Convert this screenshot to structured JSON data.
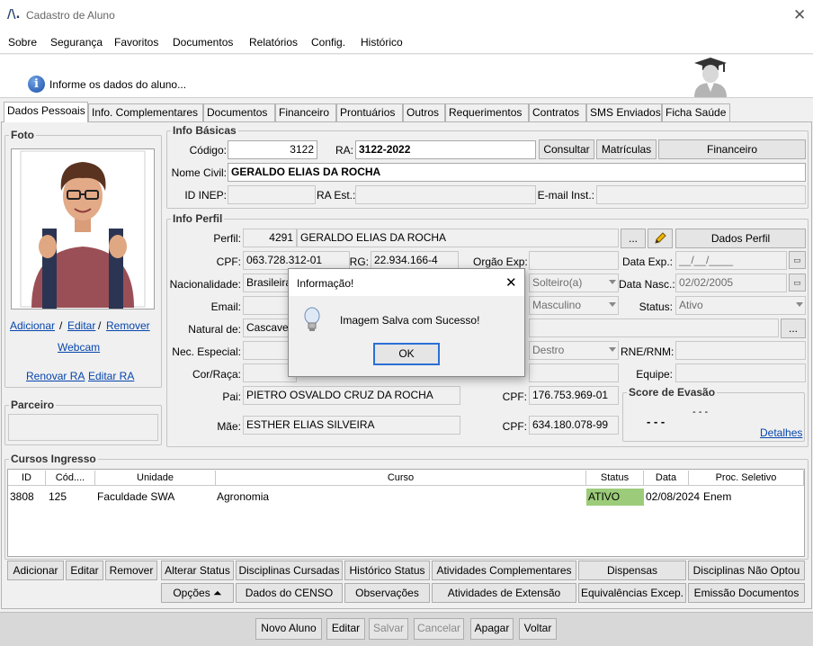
{
  "window": {
    "title": "Cadastro de Aluno",
    "close_glyph": "✕",
    "logo_text": "/\\."
  },
  "menu": [
    "Sobre",
    "Segurança",
    "Favoritos",
    "Documentos",
    "Relatórios",
    "Config.",
    "Histórico"
  ],
  "info": {
    "message": "Informe os dados do aluno...",
    "icon": "info-icon"
  },
  "tabs": [
    "Dados Pessoais",
    "Info. Complementares",
    "Documentos",
    "Financeiro",
    "Prontuários",
    "Outros",
    "Requerimentos",
    "Contratos",
    "SMS Enviados",
    "Ficha Saúde"
  ],
  "foto": {
    "legend": "Foto",
    "adicionar": "Adicionar",
    "editar": "Editar",
    "remover": "Remover",
    "sep": "/",
    "webcam": "Webcam",
    "renovar_ra": "Renovar RA",
    "editar_ra": "Editar RA"
  },
  "parceiro": {
    "legend": "Parceiro",
    "value": ""
  },
  "basicas": {
    "legend": "Info Básicas",
    "codigo_label": "Código:",
    "codigo": "3122",
    "ra_label": "RA:",
    "ra": "3122-2022",
    "consultar": "Consultar",
    "matriculas": "Matrículas",
    "financeiro": "Financeiro",
    "nome_label": "Nome Civil:",
    "nome": "GERALDO ELIAS DA ROCHA",
    "inep_label": "ID INEP:",
    "inep": "",
    "ra_est_label": "RA Est.:",
    "ra_est": "",
    "email_inst_label": "E-mail Inst.:",
    "email_inst": ""
  },
  "perfil": {
    "legend": "Info Perfil",
    "perfil_label": "Perfil:",
    "perfil_id": "4291",
    "perfil_nome": "GERALDO ELIAS DA ROCHA",
    "ellipsis": "...",
    "dados_perfil": "Dados Perfil",
    "cpf_label": "CPF:",
    "cpf": "063.728.312-01",
    "rg_label": "RG:",
    "rg": "22.934.166-4",
    "orgao_label": "Orgão Exp:",
    "orgao": "",
    "data_exp_label": "Data Exp.:",
    "data_exp": "__/__/____",
    "nacionalidade_label": "Nacionalidade:",
    "nacionalidade": "Brasileira",
    "estado_civil": "Solteiro(a)",
    "data_nasc_label": "Data Nasc.:",
    "data_nasc": "02/02/2005",
    "email_label": "Email:",
    "email": "",
    "sexo": "Masculino",
    "status_label": "Status:",
    "status": "Ativo",
    "natural_label": "Natural de:",
    "natural": "Cascavel",
    "nec_label": "Nec. Especial:",
    "nec": "",
    "lateralidade": "Destro",
    "rne_label": "RNE/RNM:",
    "rne": "",
    "cor_label": "Cor/Raça:",
    "cor": "",
    "equipe_label": "Equipe:",
    "equipe": "",
    "pai_label": "Pai:",
    "pai": "PIETRO OSVALDO CRUZ DA ROCHA",
    "pai_cpf_label": "CPF:",
    "pai_cpf": "176.753.969-01",
    "mae_label": "Mãe:",
    "mae": "ESTHER ELIAS SILVEIRA",
    "mae_cpf_label": "CPF:",
    "mae_cpf": "634.180.078-99",
    "score_legend": "Score de Evasão",
    "score_small": "- - -",
    "score_big": "- - -",
    "detalhes": "Detalhes",
    "cal_glyph": "▭",
    "pencil_icon": "pencil-icon"
  },
  "cursos": {
    "legend": "Cursos Ingresso",
    "columns": [
      "ID",
      "Cód....",
      "Unidade",
      "Curso",
      "Status",
      "Data",
      "Proc. Seletivo"
    ],
    "rows": [
      {
        "id": "3808",
        "cod": "125",
        "unidade": "Faculdade SWA",
        "curso": "Agronomia",
        "status": "ATIVO",
        "data": "02/08/2024",
        "proc": "Enem"
      }
    ],
    "status_color": "#9ccc7a"
  },
  "actions1": [
    "Adicionar",
    "Editar",
    "Remover",
    "Alterar Status",
    "Disciplinas Cursadas",
    "Histórico Status",
    "Atividades Complementares",
    "Dispensas",
    "Disciplinas Não Optou"
  ],
  "actions2": [
    "Opções ⏶",
    "Dados do CENSO",
    "Observações",
    "Atividades de Extensão",
    "Equivalências Excep.",
    "Emissão Documentos"
  ],
  "bottom": [
    "Novo Aluno",
    "Editar",
    "Salvar",
    "Cancelar",
    "Apagar",
    "Voltar"
  ],
  "dialog": {
    "title": "Informação!",
    "close": "✕",
    "message": "Imagem Salva com Sucesso!",
    "ok": "OK",
    "icon": "lightbulb-icon"
  }
}
